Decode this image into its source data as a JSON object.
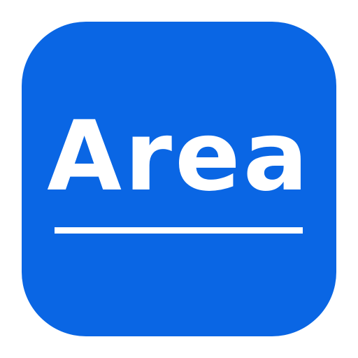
{
  "icon": {
    "label": "Area",
    "background_color": "#0a66e4",
    "text_color": "#ffffff"
  }
}
